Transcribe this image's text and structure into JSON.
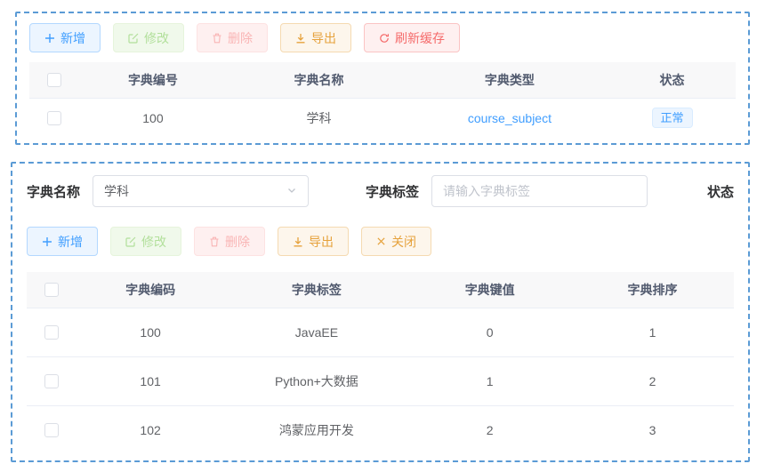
{
  "colors": {
    "primary": "#409eff",
    "success": "#67c23a",
    "danger": "#f56c6c",
    "warning": "#e6a23c",
    "panel_border": "#5b9bd5"
  },
  "top_panel": {
    "toolbar": {
      "add": "新增",
      "edit": "修改",
      "delete": "删除",
      "export": "导出",
      "refresh": "刷新缓存"
    },
    "table": {
      "headers": [
        "字典编号",
        "字典名称",
        "字典类型",
        "状态"
      ],
      "row": {
        "id": "100",
        "name": "学科",
        "type": "course_subject",
        "status": "正常"
      }
    }
  },
  "bottom_panel": {
    "form": {
      "name_label": "字典名称",
      "name_value": "学科",
      "tag_label": "字典标签",
      "tag_placeholder": "请输入字典标签",
      "status_label": "状态"
    },
    "toolbar": {
      "add": "新增",
      "edit": "修改",
      "delete": "删除",
      "export": "导出",
      "close": "关闭"
    },
    "table": {
      "headers": [
        "字典编码",
        "字典标签",
        "字典键值",
        "字典排序"
      ],
      "rows": [
        {
          "code": "100",
          "label": "JavaEE",
          "value": "0",
          "sort": "1"
        },
        {
          "code": "101",
          "label": "Python+大数据",
          "value": "1",
          "sort": "2"
        },
        {
          "code": "102",
          "label": "鸿蒙应用开发",
          "value": "2",
          "sort": "3"
        }
      ]
    }
  }
}
